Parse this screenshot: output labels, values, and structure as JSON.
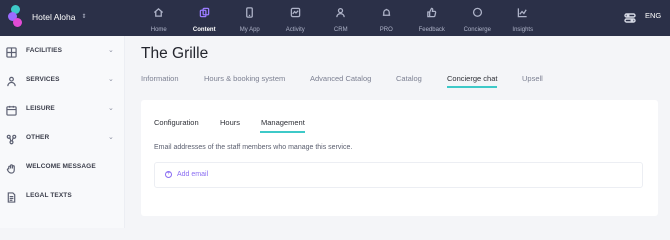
{
  "brand": {
    "hotel_name": "Hotel Aloha",
    "caret": "⇕"
  },
  "nav": [
    {
      "label": "Home",
      "icon": "home-icon",
      "active": false
    },
    {
      "label": "Content",
      "icon": "content-icon",
      "active": true
    },
    {
      "label": "My App",
      "icon": "phone-icon",
      "active": false
    },
    {
      "label": "Activity",
      "icon": "activity-icon",
      "active": false
    },
    {
      "label": "CRM",
      "icon": "users-icon",
      "active": false
    },
    {
      "label": "PRO",
      "icon": "bell-icon",
      "active": false
    },
    {
      "label": "Feedback",
      "icon": "thumbs-up-icon",
      "active": false
    },
    {
      "label": "Concierge",
      "icon": "chat-icon",
      "active": false
    },
    {
      "label": "Insights",
      "icon": "chart-icon",
      "active": false
    }
  ],
  "language": "ENG",
  "sidebar": {
    "items": [
      {
        "label": "FACILITIES",
        "icon": "grid-icon",
        "chevron": "⌄"
      },
      {
        "label": "SERVICES",
        "icon": "person-icon",
        "chevron": "⌄"
      },
      {
        "label": "LEISURE",
        "icon": "calendar-icon",
        "chevron": "⌄"
      },
      {
        "label": "OTHER",
        "icon": "nodes-icon",
        "chevron": "⌄"
      },
      {
        "label": "WELCOME MESSAGE",
        "icon": "hand-icon",
        "chevron": ""
      },
      {
        "label": "LEGAL TEXTS",
        "icon": "document-icon",
        "chevron": ""
      }
    ]
  },
  "page": {
    "title": "The Grille",
    "tabs": [
      "Information",
      "Hours & booking system",
      "Advanced Catalog",
      "Catalog",
      "Concierge chat",
      "Upsell"
    ],
    "active_tab": "Concierge chat"
  },
  "card": {
    "subtabs": [
      "Configuration",
      "Hours",
      "Management"
    ],
    "active_subtab": "Management",
    "description": "Email addresses of the staff members who manage this service.",
    "add_email_label": "Add email",
    "plus_glyph": "+"
  },
  "colors": {
    "topbar": "#2b3048",
    "accent_teal": "#3ec9c8",
    "accent_purple": "#8a6df2"
  }
}
